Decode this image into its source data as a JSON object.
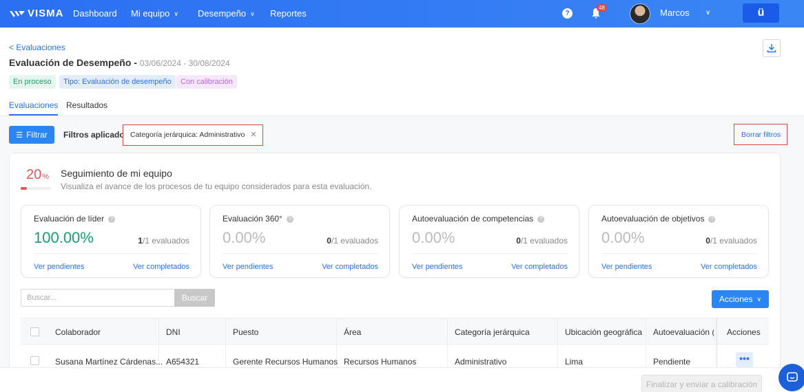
{
  "nav": {
    "brand": "VISMA",
    "items": [
      {
        "label": "Dashboard",
        "has_dropdown": false
      },
      {
        "label": "Mi equipo",
        "has_dropdown": true
      },
      {
        "label": "Desempeño",
        "has_dropdown": true
      },
      {
        "label": "Reportes",
        "has_dropdown": false
      }
    ],
    "help_icon": "question-circle-icon",
    "notifications": "48",
    "user_name": "Marcos",
    "app_button": "ü",
    "accent": "#2b6ff2"
  },
  "header": {
    "back_link": "< Evaluaciones",
    "title": "Evaluación de Desempeño - ",
    "dates": "03/06/2024 - 30/08/2024",
    "tags": [
      "En proceso",
      "Tipo: Evaluación de desempeño",
      "Con calibración"
    ]
  },
  "tabs": [
    {
      "label": "Evaluaciones",
      "active": true
    },
    {
      "label": "Resultados",
      "active": false
    }
  ],
  "filters": {
    "button": "Filtrar",
    "applied_label": "Filtros aplicados:",
    "chip": "Categoría jerárquica: Administrativo",
    "clear": "Borrar filtros"
  },
  "team": {
    "percent": "20",
    "percent_unit": "%",
    "progress": 0.2,
    "title": "Seguimiento de mi equipo",
    "subtitle": "Visualiza el avance de los procesos de tu equipo considerados para esta evaluación."
  },
  "cards": [
    {
      "title": "Evaluación de líder",
      "value": "100.00%",
      "count": "1",
      "total": "/1 evaluados",
      "link1": "Ver pendientes",
      "link2": "Ver completados"
    },
    {
      "title": "Evaluación 360°",
      "value": "0.00%",
      "count": "0",
      "total": "/1 evaluados",
      "link1": "Ver pendientes",
      "link2": "Ver completados"
    },
    {
      "title": "Autoevaluación de competencias",
      "value": "0.00%",
      "count": "0",
      "total": "/1 evaluados",
      "link1": "Ver pendientes",
      "link2": "Ver completados"
    },
    {
      "title": "Autoevaluación de objetivos",
      "value": "0.00%",
      "count": "0",
      "total": "/1 evaluados",
      "link1": "Ver pendientes",
      "link2": "Ver completados"
    }
  ],
  "search": {
    "placeholder": "Buscar...",
    "button": "Buscar",
    "actions": "Acciones"
  },
  "table": {
    "columns": [
      "Colaborador",
      "DNI",
      "Puesto",
      "Área",
      "Categoría jerárquica",
      "Ubicación geográfica",
      "Autoevaluación (C",
      "Acciones"
    ],
    "rows": [
      [
        "Susana Martínez Cárdenas...",
        "A654321",
        "Gerente Recursos Humanos",
        "Recursos Humanos",
        "Administrativo",
        "Lima",
        "Pendiente",
        "•••"
      ]
    ]
  },
  "footer": {
    "finalize": "Finalizar y enviar a calibración"
  }
}
